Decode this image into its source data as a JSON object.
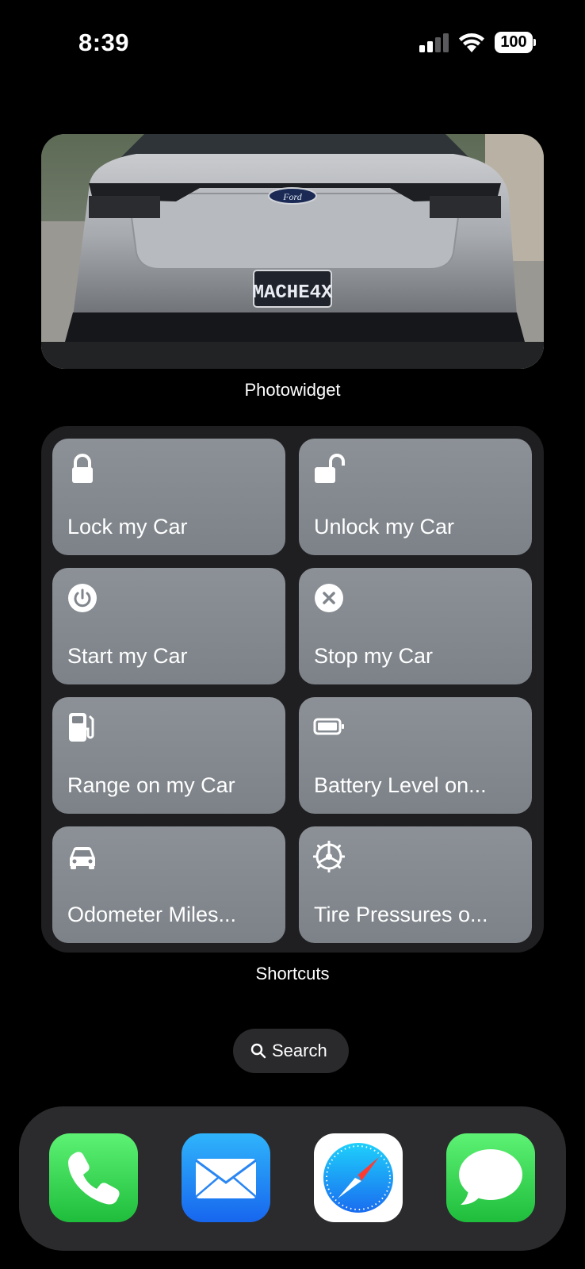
{
  "status_bar": {
    "time": "8:39",
    "battery_percent": "100"
  },
  "photo_widget": {
    "label": "Photowidget",
    "plate_text": "MACHE4X",
    "badge_text": "Ford"
  },
  "shortcuts_widget": {
    "label": "Shortcuts",
    "items": [
      {
        "label": "Lock my Car",
        "icon": "lock-icon"
      },
      {
        "label": "Unlock my Car",
        "icon": "unlock-icon"
      },
      {
        "label": "Start my Car",
        "icon": "power-icon"
      },
      {
        "label": "Stop my Car",
        "icon": "x-circle-icon"
      },
      {
        "label": "Range on my Car",
        "icon": "fuel-pump-icon"
      },
      {
        "label": "Battery Level on...",
        "icon": "battery-icon"
      },
      {
        "label": "Odometer Miles...",
        "icon": "car-icon"
      },
      {
        "label": "Tire Pressures o...",
        "icon": "steering-wheel-icon"
      }
    ]
  },
  "search": {
    "label": "Search"
  },
  "dock": {
    "apps": [
      {
        "name": "Phone",
        "icon": "phone-icon",
        "color": "#34c759"
      },
      {
        "name": "Mail",
        "icon": "mail-icon",
        "color": "#1e7cf2"
      },
      {
        "name": "Safari",
        "icon": "safari-icon",
        "color": "#ffffff"
      },
      {
        "name": "Messages",
        "icon": "messages-icon",
        "color": "#34c759"
      }
    ]
  }
}
